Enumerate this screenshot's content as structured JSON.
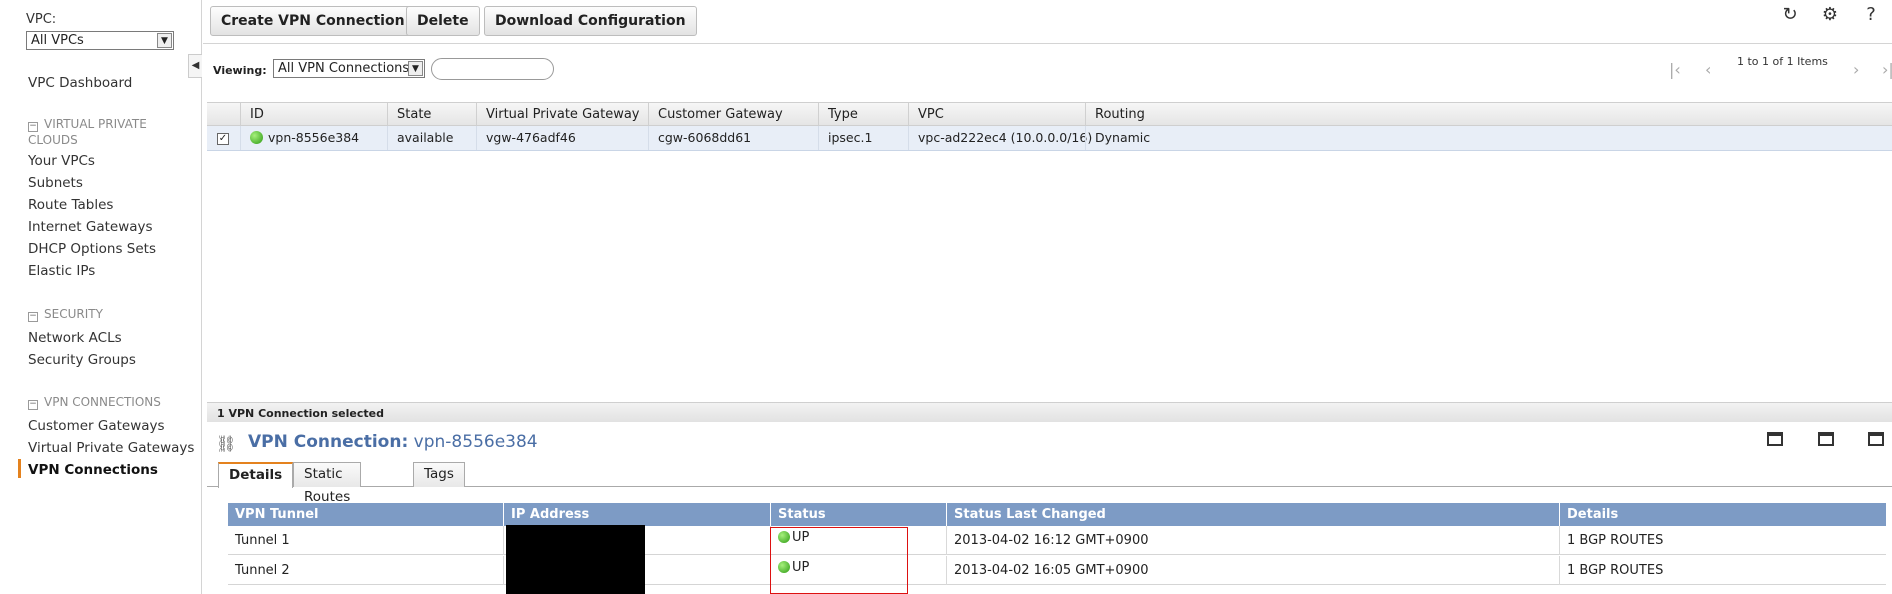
{
  "sidebar": {
    "vpc_label": "VPC:",
    "vpc_select_value": "All VPCs",
    "dashboard": "VPC Dashboard",
    "sections": [
      {
        "title": "VIRTUAL PRIVATE CLOUDS",
        "items": [
          "Your VPCs",
          "Subnets",
          "Route Tables",
          "Internet Gateways",
          "DHCP Options Sets",
          "Elastic IPs"
        ]
      },
      {
        "title": "SECURITY",
        "items": [
          "Network ACLs",
          "Security Groups"
        ]
      },
      {
        "title": "VPN CONNECTIONS",
        "items": [
          "Customer Gateways",
          "Virtual Private Gateways",
          "VPN Connections"
        ]
      }
    ],
    "active_item": "VPN Connections"
  },
  "toolbar": {
    "create_label": "Create VPN Connection",
    "delete_label": "Delete",
    "download_label": "Download Configuration"
  },
  "viewbar": {
    "viewing_label": "Viewing:",
    "viewing_value": "All VPN Connections",
    "pager_text": "1 to 1 of 1 Items"
  },
  "grid": {
    "columns": [
      "ID",
      "State",
      "Virtual Private Gateway",
      "Customer Gateway",
      "Type",
      "VPC",
      "Routing"
    ],
    "rows": [
      {
        "id": "vpn-8556e384",
        "state": "available",
        "vgw": "vgw-476adf46",
        "cgw": "cgw-6068dd61",
        "type": "ipsec.1",
        "vpc": "vpc-ad222ec4 (10.0.0.0/16)",
        "routing": "Dynamic"
      }
    ]
  },
  "details": {
    "selected_text": "1 VPN Connection selected",
    "title_prefix": "VPN Connection:",
    "title_id": "vpn-8556e384",
    "tabs": [
      "Details",
      "Static Routes",
      "Tags"
    ],
    "tunnel_columns": [
      "VPN Tunnel",
      "IP Address",
      "Status",
      "Status Last Changed",
      "Details"
    ],
    "tunnels": [
      {
        "name": "Tunnel 1",
        "ip": "",
        "status": "UP",
        "changed": "2013-04-02 16:12 GMT+0900",
        "details": "1 BGP ROUTES"
      },
      {
        "name": "Tunnel 2",
        "ip": "",
        "status": "UP",
        "changed": "2013-04-02 16:05 GMT+0900",
        "details": "1 BGP ROUTES"
      }
    ]
  },
  "colors": {
    "accent": "#e4821e",
    "table_header": "#7d9bc5",
    "title": "#4a6ea5"
  }
}
